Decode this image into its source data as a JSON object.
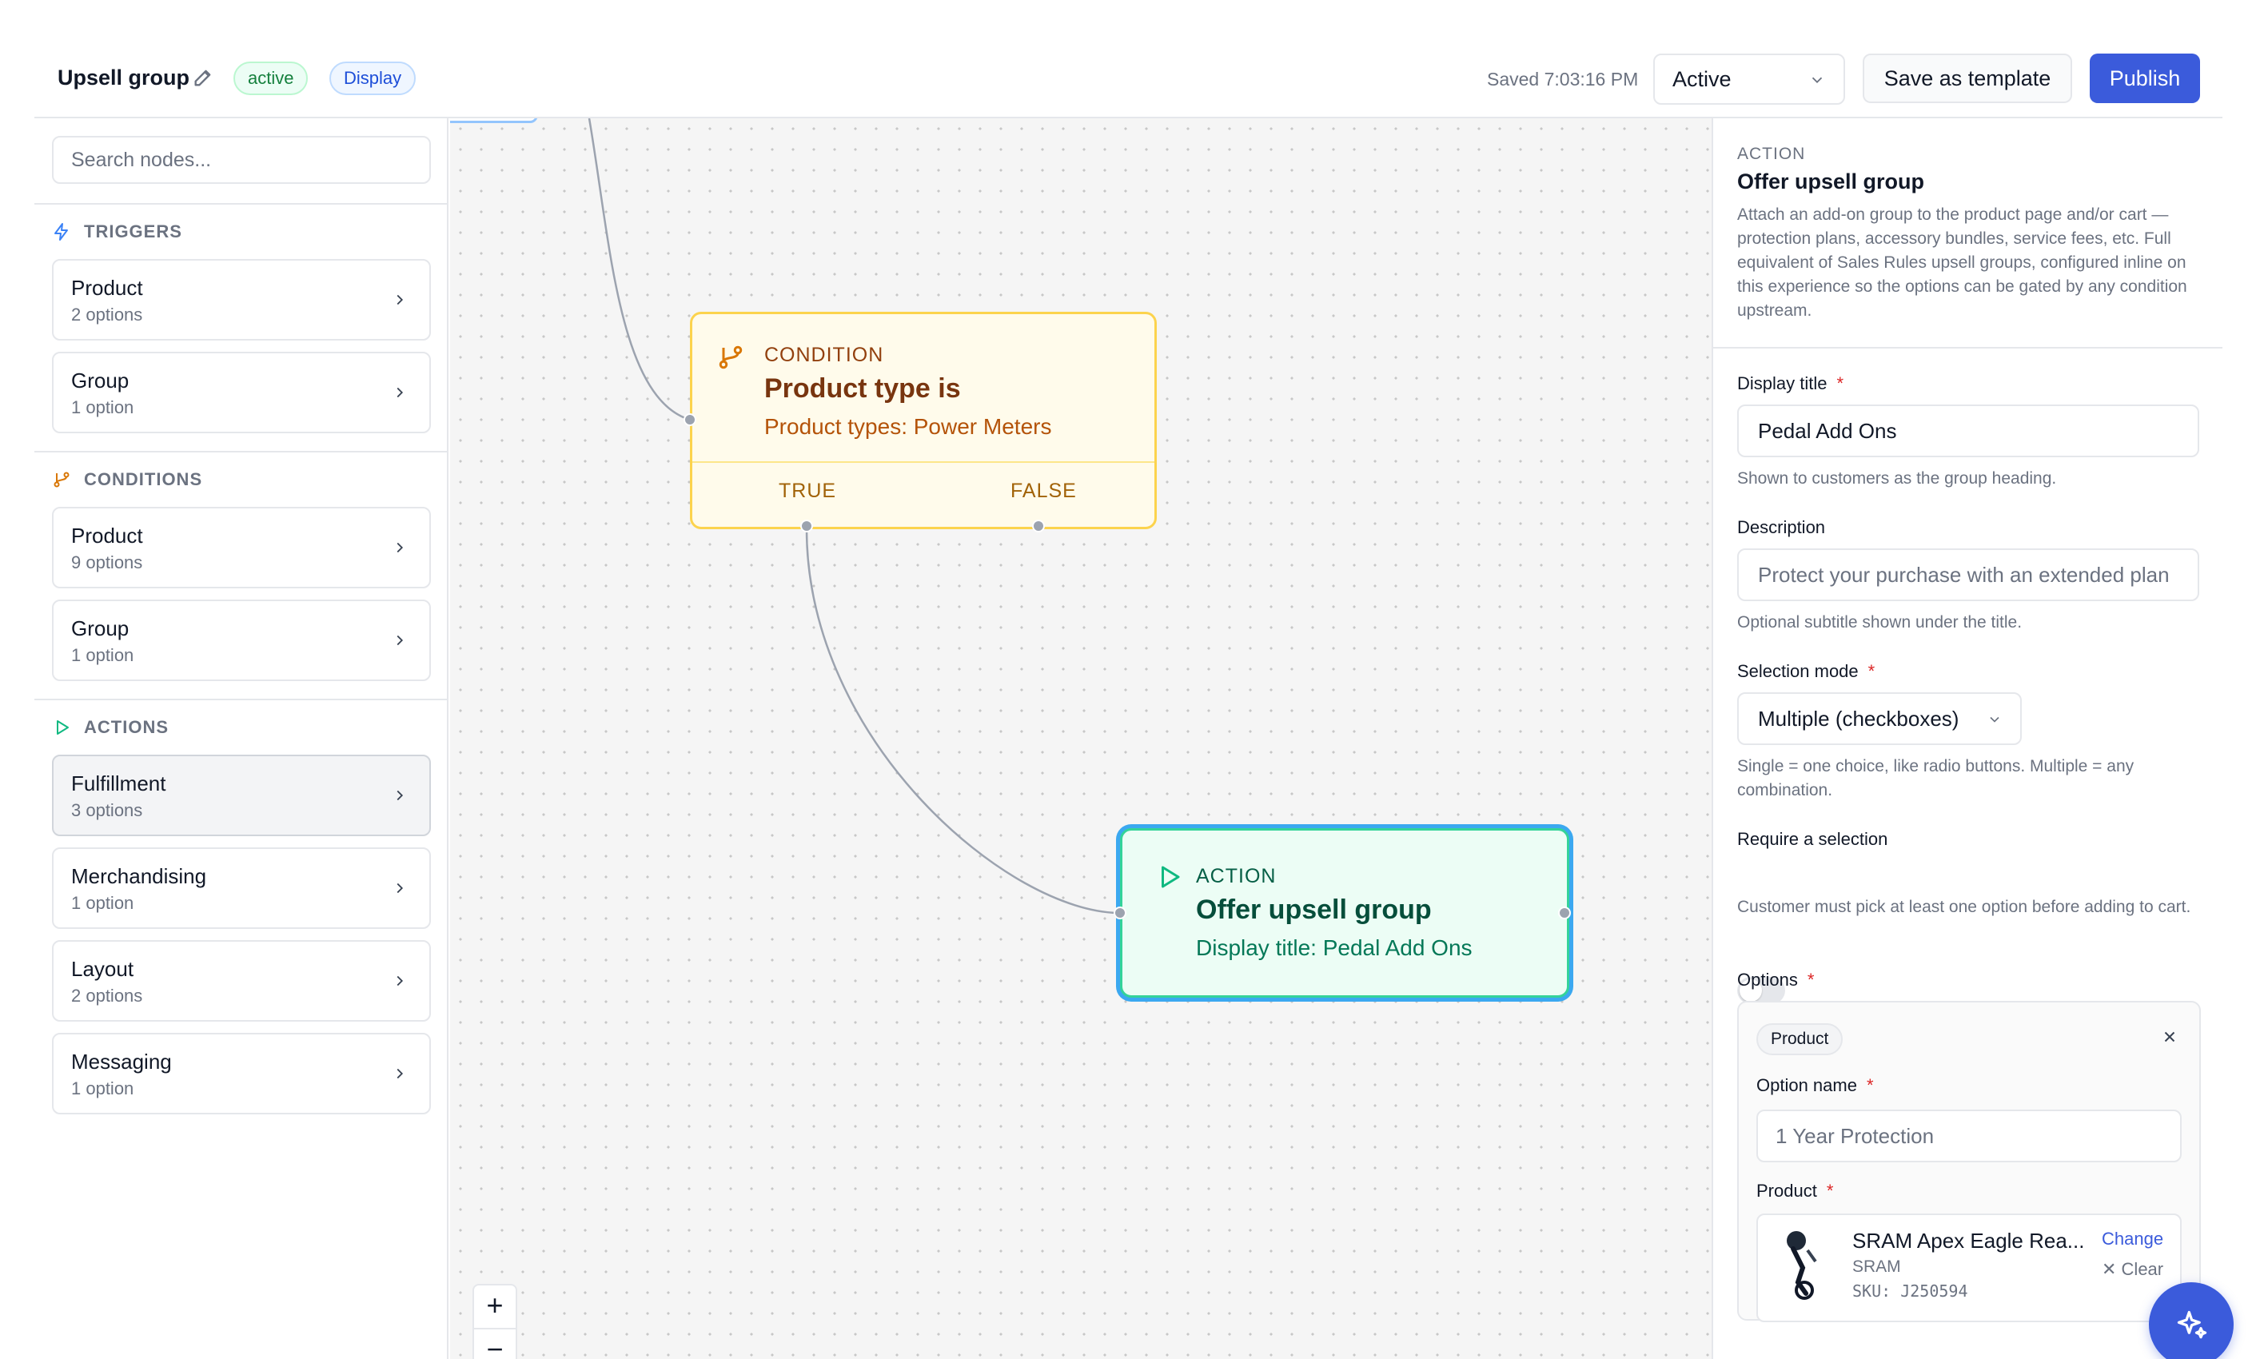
{
  "header": {
    "title": "Upsell group",
    "badge_status": "active",
    "badge_type": "Display",
    "saved_text": "Saved 7:03:16 PM",
    "status_value": "Active",
    "save_template_label": "Save as template",
    "publish_label": "Publish"
  },
  "sidebar": {
    "search_placeholder": "Search nodes...",
    "triggers_label": "TRIGGERS",
    "triggers": [
      {
        "name": "Product",
        "sub": "2 options"
      },
      {
        "name": "Group",
        "sub": "1 option"
      }
    ],
    "conditions_label": "CONDITIONS",
    "conditions": [
      {
        "name": "Product",
        "sub": "9 options"
      },
      {
        "name": "Group",
        "sub": "1 option"
      }
    ],
    "actions_label": "ACTIONS",
    "actions": [
      {
        "name": "Fulfillment",
        "sub": "3 options"
      },
      {
        "name": "Merchandising",
        "sub": "1 option"
      },
      {
        "name": "Layout",
        "sub": "2 options"
      },
      {
        "name": "Messaging",
        "sub": "1 option"
      }
    ]
  },
  "canvas": {
    "condition_node": {
      "kind": "CONDITION",
      "title": "Product type is",
      "desc": "Product types: Power Meters",
      "true_label": "TRUE",
      "false_label": "FALSE"
    },
    "action_node": {
      "kind": "ACTION",
      "title": "Offer upsell group",
      "desc": "Display title: Pedal Add Ons"
    },
    "zoom_in": "+",
    "zoom_out": "−"
  },
  "panel": {
    "kind": "ACTION",
    "title": "Offer upsell group",
    "description": "Attach an add-on group to the product page and/or cart — protection plans, accessory bundles, service fees, etc. Full equivalent of Sales Rules upsell groups, configured inline on this experience so the options can be gated by any condition upstream.",
    "display_title_label": "Display title",
    "display_title_value": "Pedal Add Ons",
    "display_title_help": "Shown to customers as the group heading.",
    "description_label": "Description",
    "description_placeholder": "Protect your purchase with an extended plan",
    "description_help": "Optional subtitle shown under the title.",
    "selection_mode_label": "Selection mode",
    "selection_mode_value": "Multiple (checkboxes)",
    "selection_mode_help": "Single = one choice, like radio buttons. Multiple = any combination.",
    "require_label": "Require a selection",
    "require_on": false,
    "require_help": "Customer must pick at least one option before adding to cart.",
    "options_label": "Options",
    "required_mark": "*",
    "option": {
      "chip": "Product",
      "name_label": "Option name",
      "name_placeholder": "1 Year Protection",
      "product_label": "Product",
      "product_name": "SRAM Apex Eagle Rea...",
      "product_brand": "SRAM",
      "product_sku": "SKU: J250594",
      "change_label": "Change",
      "clear_label": "Clear"
    }
  },
  "icons": {
    "pencil": "pencil-icon",
    "triggers": "lightning-icon",
    "conditions": "branch-icon",
    "actions": "play-icon",
    "fab": "sparkles-icon"
  },
  "colors": {
    "accent": "#3b5bdb",
    "condition_bg": "#fffbeb",
    "condition_border": "#fcd34d",
    "action_bg": "#ecfdf5",
    "action_border": "#34d399",
    "selection_ring": "#3ba8f0"
  }
}
